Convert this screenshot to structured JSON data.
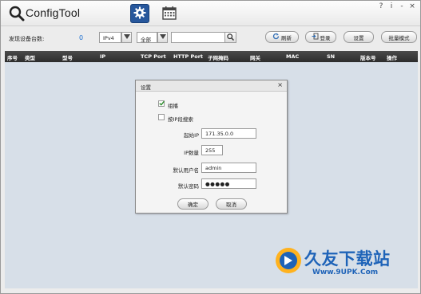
{
  "app": {
    "title": "ConfigTool",
    "window_controls": [
      "?",
      "i",
      "-",
      "×"
    ]
  },
  "toolbar": {
    "found_label": "发现设备台数:",
    "found_count": "0",
    "ip_version": "IPv4",
    "filter": "全部",
    "search_value": "",
    "refresh_label": "刷新",
    "login_label": "登录",
    "settings_label": "设置",
    "batch_label": "批量模式"
  },
  "table": {
    "columns": [
      "序号",
      "类型",
      "型号",
      "IP",
      "TCP Port",
      "HTTP Port",
      "子网掩码",
      "网关",
      "MAC",
      "SN",
      "版本号",
      "操作"
    ],
    "rows": []
  },
  "dialog": {
    "title": "设置",
    "close": "×",
    "multicast_label": "组播",
    "multicast_checked": true,
    "ip_search_label": "按IP段搜索",
    "ip_search_checked": false,
    "start_ip_label": "起始IP",
    "start_ip_value": "171.35.0.0",
    "ip_count_label": "IP数量",
    "ip_count_value": "255",
    "username_label": "默认用户名",
    "username_value": "admin",
    "password_label": "默认密码",
    "password_value": "●●●●●",
    "ok_label": "确定",
    "cancel_label": "取消"
  },
  "watermark": {
    "text": "久友下载站",
    "url": "Www.9UPK.Com"
  },
  "colors": {
    "accent": "#27579c",
    "count": "#1d6fd1",
    "table_header": "#3a3a3a",
    "table_body": "#d7dfe8",
    "watermark": "#1e63b8"
  }
}
